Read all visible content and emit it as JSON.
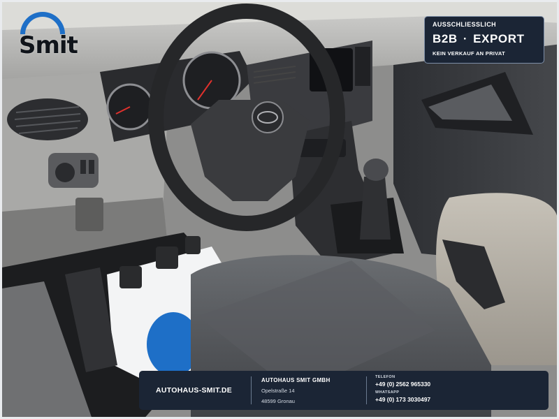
{
  "logo": {
    "text": "Smit",
    "color": "#1e6fc7"
  },
  "badge": {
    "top": "AUSSCHLIESSLICH",
    "left": "B2B",
    "separator": "·",
    "right": "EXPORT",
    "bottom": "KEIN VERKAUF AN PRIVAT"
  },
  "footer": {
    "website": "AUTOHAUS-SMIT.DE",
    "company": "AUTOHAUS SMIT GMBH",
    "street": "Opelstraße 14",
    "city": "48599 Gronau",
    "phone_label": "TELEFON",
    "phone": "+49 (0) 2562 965330",
    "whatsapp_label": "WHATSAPP",
    "whatsapp": "+49 (0) 173 3030497"
  },
  "colors": {
    "panel": "#1b2535",
    "brand_blue": "#1e6fc7"
  }
}
